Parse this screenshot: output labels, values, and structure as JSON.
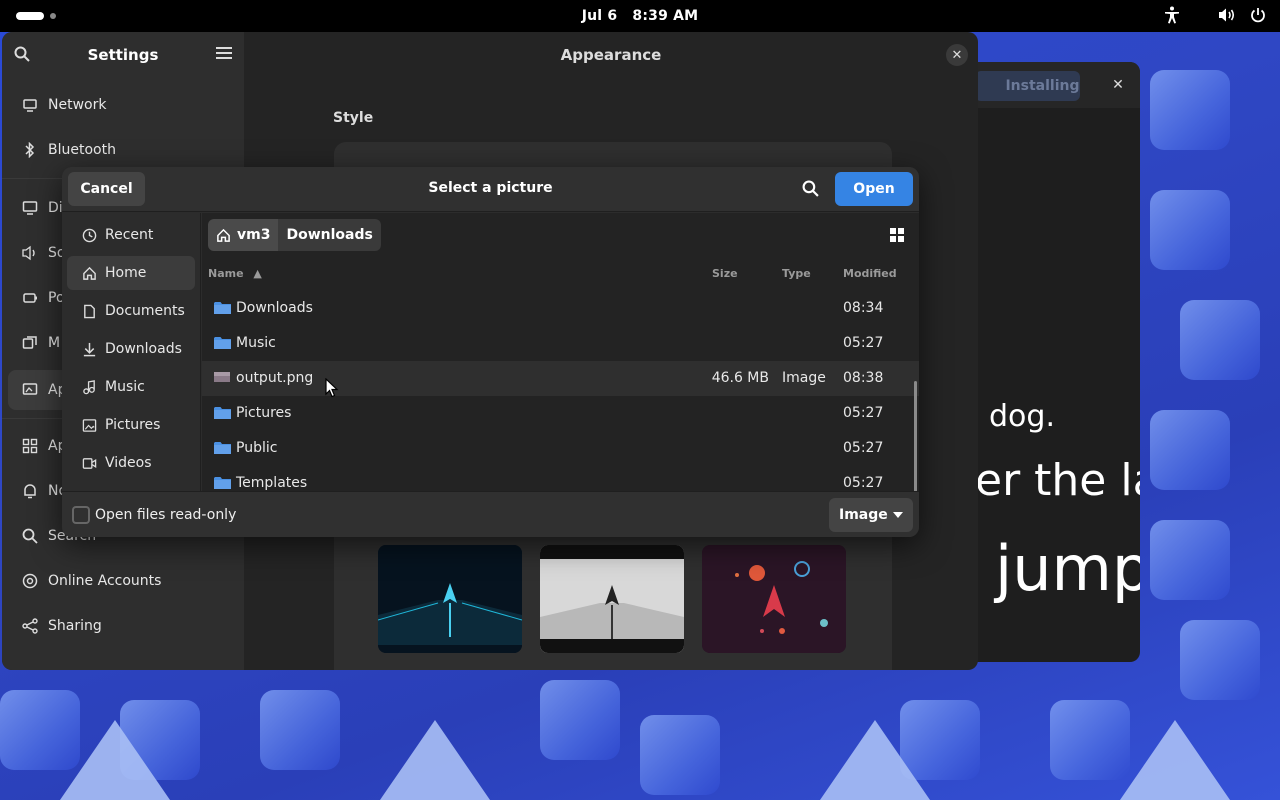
{
  "topbar": {
    "date": "Jul 6",
    "time": "8:39 AM"
  },
  "background_window": {
    "installing_label": "Installing",
    "text_lines": [
      "dog.",
      "er the la",
      "jump"
    ]
  },
  "settings": {
    "title": "Settings",
    "page_title": "Appearance",
    "style_label": "Style",
    "sidebar_items": [
      {
        "label": "Network",
        "icon": "network-icon"
      },
      {
        "label": "Bluetooth",
        "icon": "bluetooth-icon"
      },
      {
        "label": "Di",
        "icon": "display-icon"
      },
      {
        "label": "So",
        "icon": "sound-icon"
      },
      {
        "label": "Po",
        "icon": "power-icon"
      },
      {
        "label": "M",
        "icon": "multitasking-icon"
      },
      {
        "label": "Ap",
        "icon": "appearance-icon"
      },
      {
        "label": "Ap",
        "icon": "apps-icon"
      },
      {
        "label": "No",
        "icon": "notifications-icon"
      },
      {
        "label": "Search",
        "icon": "search-icon"
      },
      {
        "label": "Online Accounts",
        "icon": "online-accounts-icon"
      },
      {
        "label": "Sharing",
        "icon": "sharing-icon"
      }
    ]
  },
  "dialog": {
    "title": "Select a picture",
    "cancel_label": "Cancel",
    "open_label": "Open",
    "places": [
      {
        "label": "Recent",
        "icon": "recent-icon"
      },
      {
        "label": "Home",
        "icon": "home-icon"
      },
      {
        "label": "Documents",
        "icon": "documents-icon"
      },
      {
        "label": "Downloads",
        "icon": "downloads-icon"
      },
      {
        "label": "Music",
        "icon": "music-icon"
      },
      {
        "label": "Pictures",
        "icon": "pictures-icon"
      },
      {
        "label": "Videos",
        "icon": "videos-icon"
      }
    ],
    "path": {
      "home": "vm3",
      "current": "Downloads"
    },
    "columns": {
      "name": "Name",
      "size": "Size",
      "type": "Type",
      "modified": "Modified"
    },
    "files": [
      {
        "name": "Downloads",
        "size": "",
        "type": "",
        "modified": "08:34",
        "kind": "folder"
      },
      {
        "name": "Music",
        "size": "",
        "type": "",
        "modified": "05:27",
        "kind": "folder"
      },
      {
        "name": "output.png",
        "size": "46.6 MB",
        "type": "Image",
        "modified": "08:38",
        "kind": "image"
      },
      {
        "name": "Pictures",
        "size": "",
        "type": "",
        "modified": "05:27",
        "kind": "folder"
      },
      {
        "name": "Public",
        "size": "",
        "type": "",
        "modified": "05:27",
        "kind": "folder"
      },
      {
        "name": "Templates",
        "size": "",
        "type": "",
        "modified": "05:27",
        "kind": "folder"
      }
    ],
    "read_only_label": "Open files read-only",
    "filter_label": "Image"
  },
  "colors": {
    "accent": "#3584e4",
    "folder": "#4a90e2"
  }
}
